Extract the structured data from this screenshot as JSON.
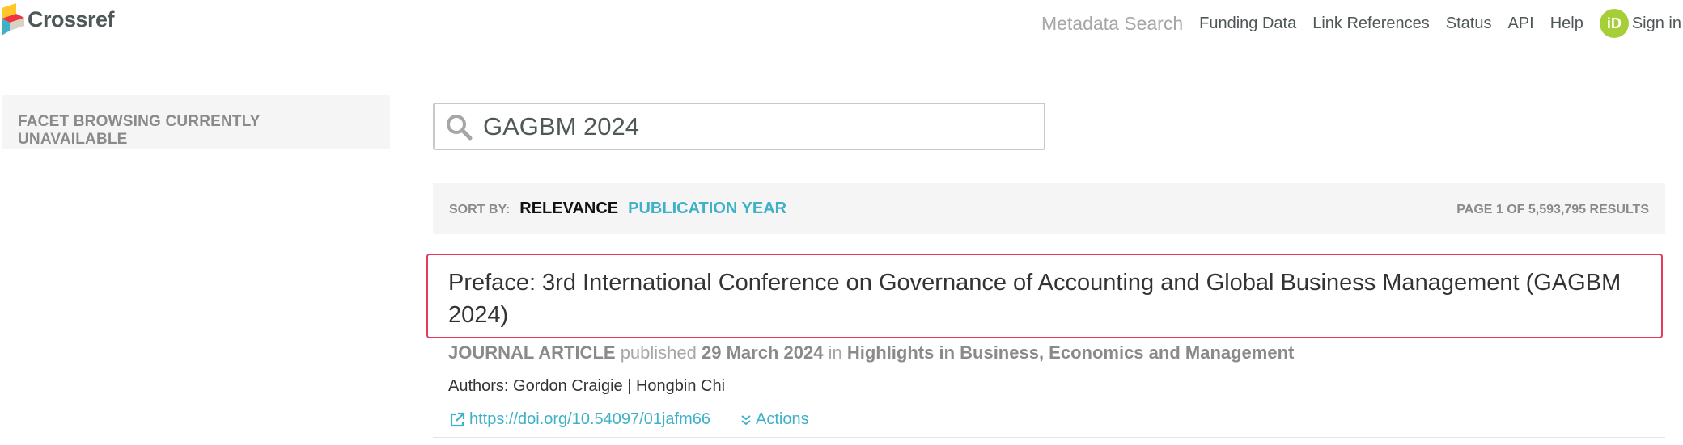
{
  "brand": {
    "name": "Crossref"
  },
  "nav": {
    "items": [
      {
        "label": "Metadata Search",
        "muted": true
      },
      {
        "label": "Funding Data",
        "muted": false
      },
      {
        "label": "Link References",
        "muted": false
      },
      {
        "label": "Status",
        "muted": false
      },
      {
        "label": "API",
        "muted": false
      },
      {
        "label": "Help",
        "muted": false
      }
    ],
    "orcid_badge": "iD",
    "signin_label": "Sign in"
  },
  "facet": {
    "message": "FACET BROWSING CURRENTLY UNAVAILABLE"
  },
  "search": {
    "query": "GAGBM 2024",
    "icon": "search-icon"
  },
  "sort": {
    "label": "SORT BY:",
    "options": [
      {
        "label": "RELEVANCE",
        "active": true
      },
      {
        "label": "PUBLICATION YEAR",
        "active": false
      }
    ],
    "page_info": "PAGE 1 OF 5,593,795 RESULTS"
  },
  "results": [
    {
      "title": "Preface: 3rd International Conference on Governance of Accounting and Global Business Management (GAGBM 2024)",
      "type": "JOURNAL ARTICLE",
      "published_word": "published",
      "date": "29 March 2024",
      "in_word": "in",
      "venue": "Highlights in Business, Economics and Management",
      "authors_label": "Authors:",
      "authors": "Gordon Craigie | Hongbin Chi",
      "doi": "https://doi.org/10.54097/01jafm66",
      "actions_label": "Actions"
    }
  ],
  "colors": {
    "accent": "#3eb1c8",
    "highlight_border": "#e8395a",
    "orcid": "#a6ce39",
    "text": "#4f5858",
    "muted": "#a6a6a6"
  }
}
